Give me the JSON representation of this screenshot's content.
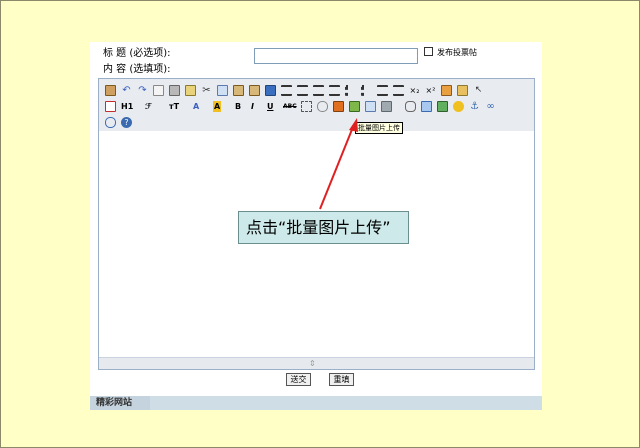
{
  "form": {
    "title_label": "标    题  (必选项):",
    "content_label": "内    容  (选填项):",
    "title_value": "",
    "vote_label": "发布投票帖"
  },
  "toolbar": {
    "row3": [
      "remove-format",
      "help"
    ],
    "heading_label": "H1",
    "font_label": "ℱ",
    "size_label": "тT",
    "color_label": "A",
    "bold_label": "B",
    "italic_label": "I",
    "underline_label": "U",
    "strike_label": "ABC"
  },
  "tooltip": "批量图片上传",
  "callout": "点击“批量图片上传”",
  "buttons": {
    "submit": "送交",
    "reset": "重填"
  },
  "footer": {
    "tab": "精彩网站"
  },
  "colors": {
    "background": "#ffffc6",
    "arrow": "#e02020",
    "callout_bg": "#cde9e9"
  }
}
